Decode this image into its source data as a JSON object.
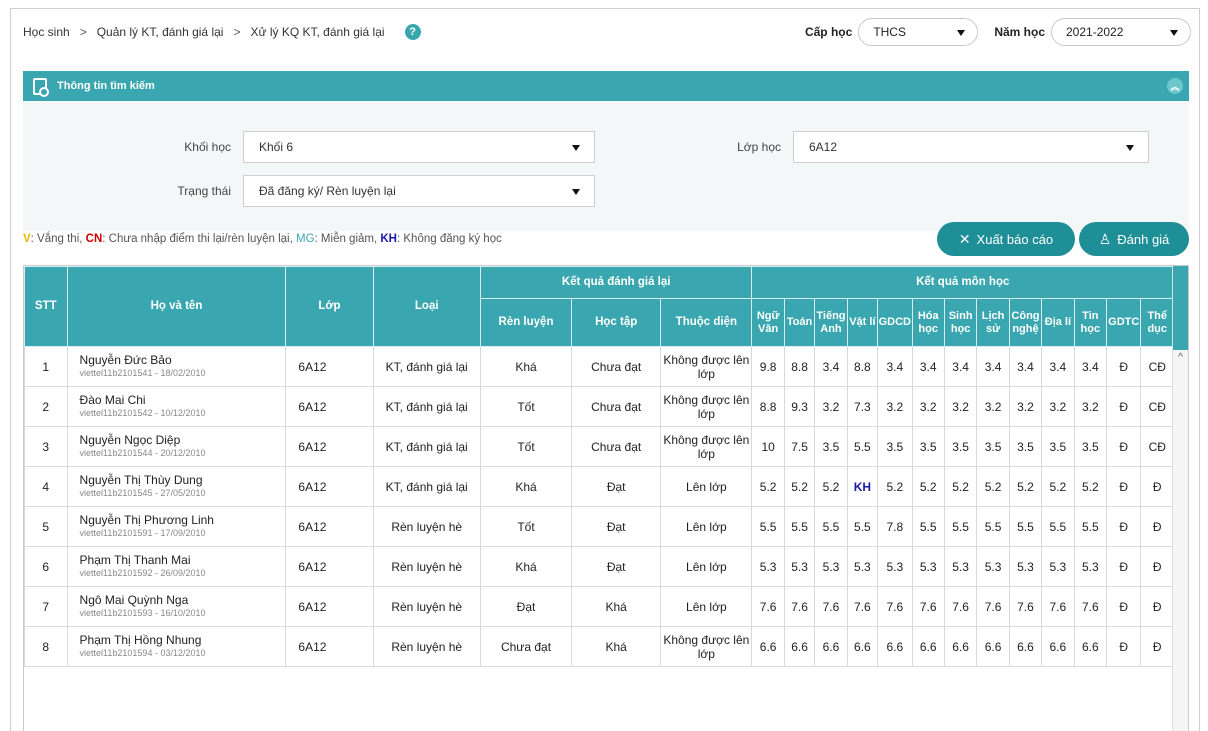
{
  "breadcrumb": [
    "Học sinh",
    "Quản lý KT, đánh giá lại",
    "Xử lý KQ KT, đánh giá lại"
  ],
  "breadcrumb_sep": ">",
  "help_icon": "?",
  "filters_top": {
    "cap_hoc_label": "Cấp học",
    "cap_hoc_value": "THCS",
    "nam_hoc_label": "Năm học",
    "nam_hoc_value": "2021-2022"
  },
  "panel": {
    "title": "Thông tin tìm kiếm",
    "khoi_label": "Khối học",
    "khoi_value": "Khối 6",
    "lop_label": "Lớp học",
    "lop_value": "6A12",
    "trangthai_label": "Trạng thái",
    "trangthai_value": "Đã đăng ký/ Rèn luyện lại"
  },
  "legend": {
    "v": "V",
    "v_text": ": Vắng thi, ",
    "cn": "CN",
    "cn_text": ": Chưa nhập điểm thi lại/rèn luyện lại, ",
    "mg": "MG",
    "mg_text": ": Miễn giảm, ",
    "kh": "KH",
    "kh_text": ": Không đăng ký học"
  },
  "buttons": {
    "export": "Xuất báo cáo",
    "evaluate": "Đánh giá"
  },
  "table": {
    "h_stt": "STT",
    "h_name": "Họ và tên",
    "h_class": "Lớp",
    "h_type": "Loại",
    "h_group1": "Kết quả đánh giá lại",
    "h_group2": "Kết quả môn học",
    "h_renluyen": "Rèn luyện",
    "h_hoctap": "Học tập",
    "h_thuocdien": "Thuộc diện",
    "subjects": [
      "Ngữ Văn",
      "Toán",
      "Tiếng Anh",
      "Vật lí",
      "GDCD",
      "Hóa học",
      "Sinh học",
      "Lịch sử",
      "Công nghệ",
      "Địa lí",
      "Tin học",
      "GDTC",
      "Thể dục"
    ],
    "rows": [
      {
        "stt": "1",
        "name": "Nguyễn Đức Bảo",
        "sub": "viettel11b2101541 - 18/02/2010",
        "lop": "6A12",
        "loai": "KT, đánh giá lại",
        "rl": "Khá",
        "ht": "Chưa đạt",
        "td": "Không được lên lớp",
        "scores": [
          "9.8",
          "8.8",
          "3.4",
          "8.8",
          "3.4",
          "3.4",
          "3.4",
          "3.4",
          "3.4",
          "3.4",
          "3.4",
          "Đ",
          "CĐ"
        ]
      },
      {
        "stt": "2",
        "name": "Đào Mai Chi",
        "sub": "viettel11b2101542 - 10/12/2010",
        "lop": "6A12",
        "loai": "KT, đánh giá lại",
        "rl": "Tốt",
        "ht": "Chưa đạt",
        "td": "Không được lên lớp",
        "scores": [
          "8.8",
          "9.3",
          "3.2",
          "7.3",
          "3.2",
          "3.2",
          "3.2",
          "3.2",
          "3.2",
          "3.2",
          "3.2",
          "Đ",
          "CĐ"
        ]
      },
      {
        "stt": "3",
        "name": "Nguyễn Ngọc Diệp",
        "sub": "viettel11b2101544 - 20/12/2010",
        "lop": "6A12",
        "loai": "KT, đánh giá lại",
        "rl": "Tốt",
        "ht": "Chưa đạt",
        "td": "Không được lên lớp",
        "scores": [
          "10",
          "7.5",
          "3.5",
          "5.5",
          "3.5",
          "3.5",
          "3.5",
          "3.5",
          "3.5",
          "3.5",
          "3.5",
          "Đ",
          "CĐ"
        ]
      },
      {
        "stt": "4",
        "name": "Nguyễn Thị Thùy Dung",
        "sub": "viettel11b2101545 - 27/05/2010",
        "lop": "6A12",
        "loai": "KT, đánh giá lại",
        "rl": "Khá",
        "ht": "Đạt",
        "td": "Lên lớp",
        "scores": [
          "5.2",
          "5.2",
          "5.2",
          "KH",
          "5.2",
          "5.2",
          "5.2",
          "5.2",
          "5.2",
          "5.2",
          "5.2",
          "Đ",
          "Đ"
        ]
      },
      {
        "stt": "5",
        "name": "Nguyễn Thị Phương Linh",
        "sub": "viettel11b2101591 - 17/09/2010",
        "lop": "6A12",
        "loai": "Rèn luyện hè",
        "rl": "Tốt",
        "ht": "Đạt",
        "td": "Lên lớp",
        "scores": [
          "5.5",
          "5.5",
          "5.5",
          "5.5",
          "7.8",
          "5.5",
          "5.5",
          "5.5",
          "5.5",
          "5.5",
          "5.5",
          "Đ",
          "Đ"
        ]
      },
      {
        "stt": "6",
        "name": "Phạm Thị Thanh Mai",
        "sub": "viettel11b2101592 - 26/09/2010",
        "lop": "6A12",
        "loai": "Rèn luyện hè",
        "rl": "Khá",
        "ht": "Đạt",
        "td": "Lên lớp",
        "scores": [
          "5.3",
          "5.3",
          "5.3",
          "5.3",
          "5.3",
          "5.3",
          "5.3",
          "5.3",
          "5.3",
          "5.3",
          "5.3",
          "Đ",
          "Đ"
        ]
      },
      {
        "stt": "7",
        "name": "Ngô Mai Quỳnh Nga",
        "sub": "viettel11b2101593 - 16/10/2010",
        "lop": "6A12",
        "loai": "Rèn luyện hè",
        "rl": "Đạt",
        "ht": "Khá",
        "td": "Lên lớp",
        "scores": [
          "7.6",
          "7.6",
          "7.6",
          "7.6",
          "7.6",
          "7.6",
          "7.6",
          "7.6",
          "7.6",
          "7.6",
          "7.6",
          "Đ",
          "Đ"
        ]
      },
      {
        "stt": "8",
        "name": "Phạm Thị Hồng Nhung",
        "sub": "viettel11b2101594 - 03/12/2010",
        "lop": "6A12",
        "loai": "Rèn luyện hè",
        "rl": "Chưa đạt",
        "ht": "Khá",
        "td": "Không được lên lớp",
        "scores": [
          "6.6",
          "6.6",
          "6.6",
          "6.6",
          "6.6",
          "6.6",
          "6.6",
          "6.6",
          "6.6",
          "6.6",
          "6.6",
          "Đ",
          "Đ"
        ]
      }
    ]
  },
  "icons": {
    "export": "tools-icon",
    "evaluate": "user-check-icon",
    "panel": "search-document-icon",
    "collapse": "chevron-up-icon"
  }
}
